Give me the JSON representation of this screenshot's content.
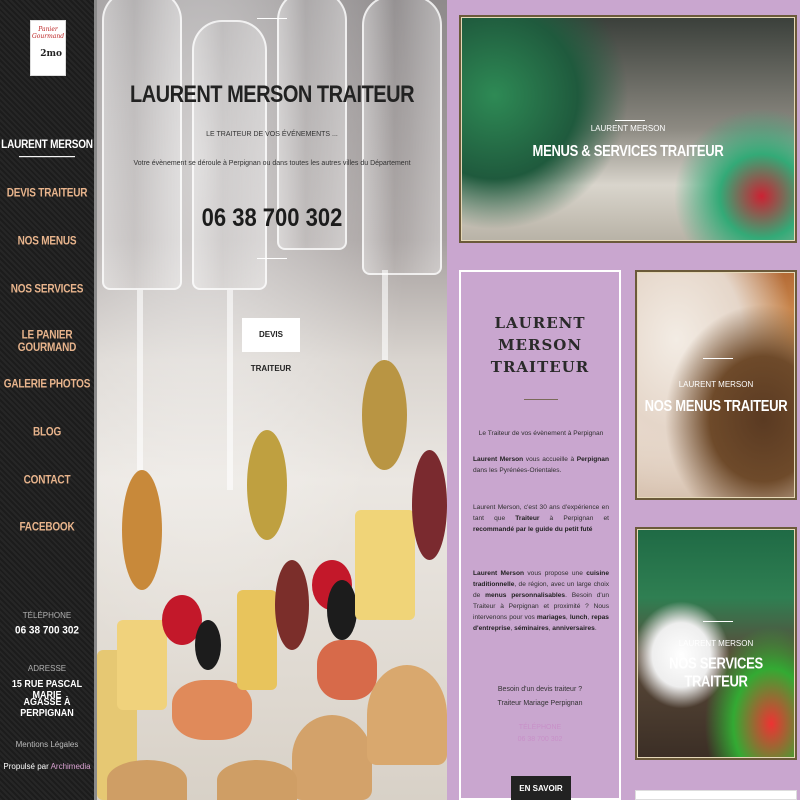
{
  "logo": {
    "line1": "Panier",
    "line2": "Gourmand",
    "line3": "2mo"
  },
  "nav": [
    "Laurent Merson",
    "Devis traiteur",
    "Nos menus",
    "Nos services",
    "Le panier gourmand",
    "Galerie photos",
    "Blog",
    "Contact",
    "Facebook"
  ],
  "sidebar": {
    "phone_label": "TÉLÉPHONE",
    "phone": "06 38 700 302",
    "address_label": "ADRESSE",
    "address_line1": "15 RUE PASCAL MARIE",
    "address_line2": "AGASSE À PERPIGNAN",
    "legal": "Mentions Légales",
    "powered_by": "Propulsé par",
    "powered_brand": "Archimedia"
  },
  "hero": {
    "title": "LAURENT MERSON TRAITEUR",
    "tagline": "LE TRAITEUR DE VOS ÉVÉNEMENTS ...",
    "description": "Votre évènement se déroule à Perpignan ou dans toutes les autres villes du Département",
    "phone": "06 38 700 302",
    "button": "DEVIS TRAITEUR"
  },
  "cards": {
    "menus": {
      "subtitle": "LAURENT MERSON",
      "title": "MENUS & SERVICES TRAITEUR"
    },
    "nos_menus": {
      "subtitle": "LAURENT MERSON",
      "title": "NOS MENUS TRAITEUR"
    },
    "nos_services": {
      "subtitle": "LAURENT MERSON",
      "title": "NOS SERVICES TRAITEUR"
    }
  },
  "text_card": {
    "title_l1": "LAURENT",
    "title_l2": "MERSON",
    "title_l3": "TRAITEUR",
    "intro": "Le Traiteur de vos évènement à Perpignan",
    "p1_a": "Laurent Merson",
    "p1_b": " vous accueille à ",
    "p1_c": "Perpignan",
    "p1_d": " dans les Pyrénées-Orientales.",
    "p2_a": "Laurent Merson, c'est 30 ans d'expérience en tant que ",
    "p2_b": "Traiteur",
    "p2_c": " à Perpignan et ",
    "p2_d": "recommandé par le guide du petit futé",
    "p3_a": "Laurent Merson",
    "p3_b": " vous propose une ",
    "p3_c": "cuisine traditionnelle",
    "p3_d": ", de région, avec un large choix de ",
    "p3_e": "menus personnalisables",
    "p3_f": ". Besoin d'un Traiteur à Perpignan et proximité ? Nous intervenons pour vos ",
    "p3_g": "mariages",
    "p3_h": ", ",
    "p3_i": "lunch",
    "p3_j": ", ",
    "p3_k": "repas d'entreprise",
    "p3_l": ", ",
    "p3_m": "séminaires",
    "p3_n": ", ",
    "p3_o": "anniversaires",
    "p3_p": ".",
    "cta_l1": "Besoin d'un devis traiteur ?",
    "cta_l2": "Traiteur Mariage Perpignan",
    "phone_label": "TÉLÉPHONE",
    "phone": "06 38 700 302",
    "button": "EN SAVOIR PLUS"
  }
}
